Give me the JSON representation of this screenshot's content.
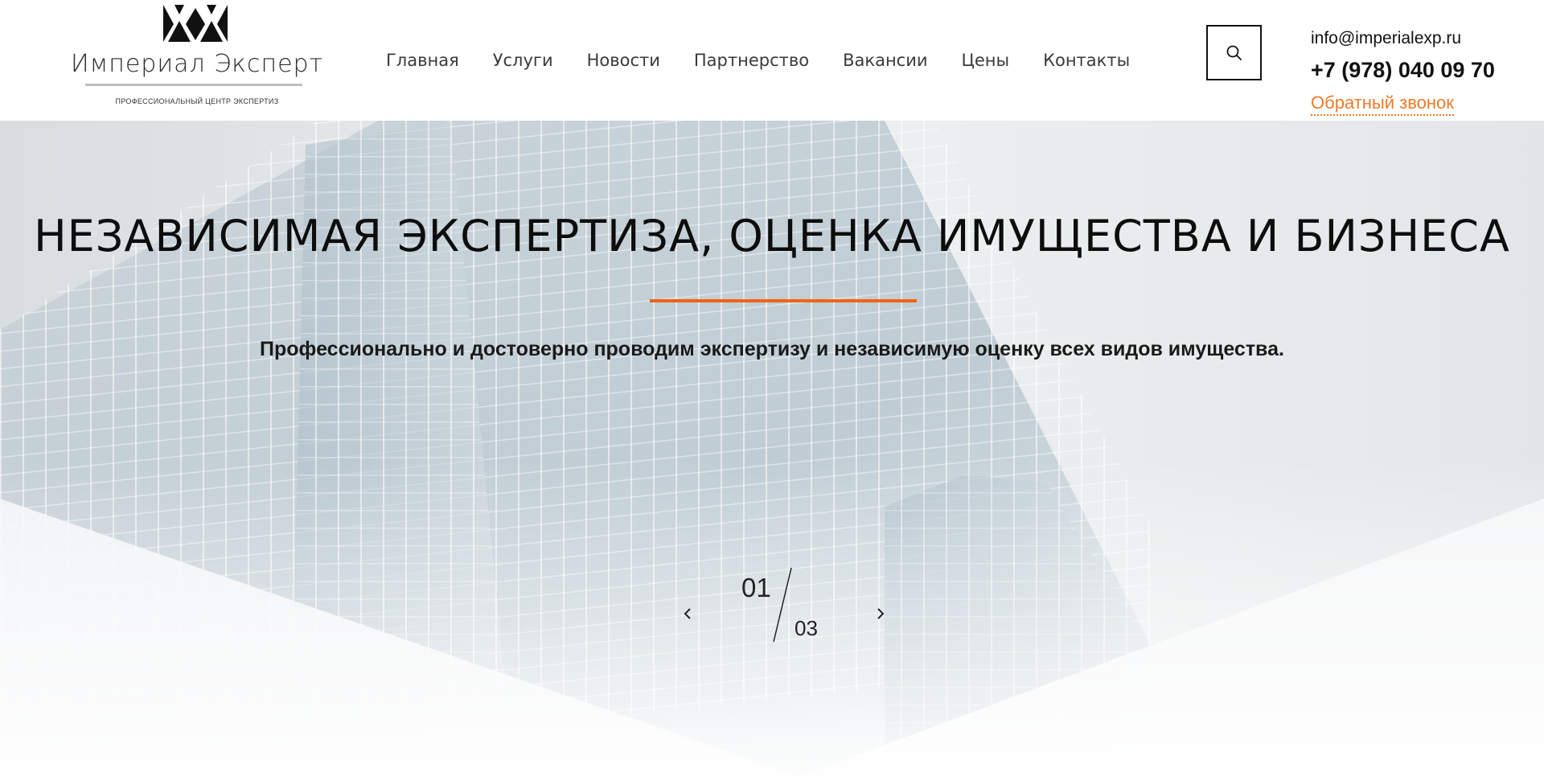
{
  "brand": {
    "name": "Империал Эксперт",
    "tagline": "профессиональный центр экспертиз",
    "logo_icon": "crown-diamonds-icon"
  },
  "nav": {
    "items": [
      {
        "label": "Главная"
      },
      {
        "label": "Услуги"
      },
      {
        "label": "Новости"
      },
      {
        "label": "Партнерство"
      },
      {
        "label": "Вакансии"
      },
      {
        "label": "Цены"
      },
      {
        "label": "Контакты"
      }
    ]
  },
  "search": {
    "icon": "search-icon"
  },
  "contacts": {
    "email": "info@imperialexp.ru",
    "phone": "+7 (978) 040 09 70",
    "callback_label": "Обратный звонок"
  },
  "hero": {
    "title": "НЕЗАВИСИМАЯ ЭКСПЕРТИЗА, ОЦЕНКА ИМУЩЕСТВА И БИЗНЕСА",
    "subtitle": "Профессионально и достоверно проводим экспертизу и независимую оценку всех видов имущества.",
    "slider": {
      "current": "01",
      "total": "03",
      "prev_icon": "chevron-left-icon",
      "next_icon": "chevron-right-icon"
    }
  },
  "colors": {
    "accent": "#f06414",
    "link": "#f07a2a",
    "text": "#111111"
  }
}
